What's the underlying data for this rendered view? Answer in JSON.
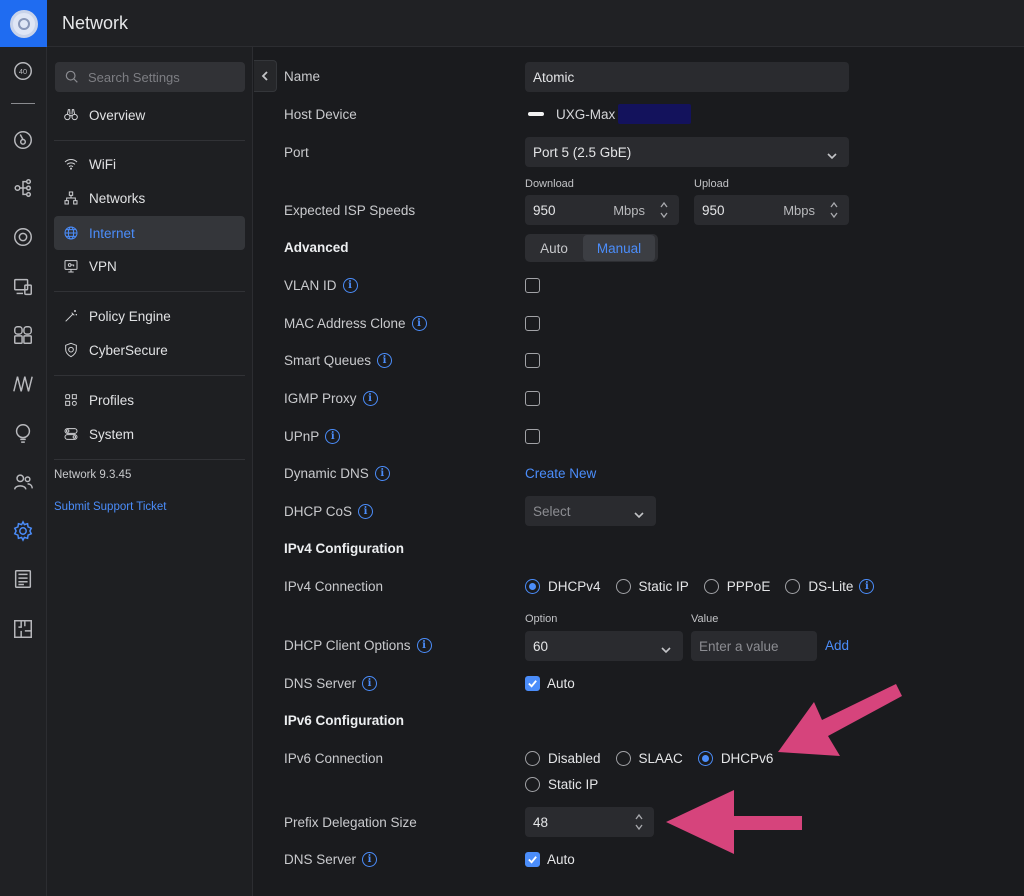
{
  "app": {
    "title": "Network"
  },
  "sidebar": {
    "search_placeholder": "Search Settings",
    "items": [
      {
        "label": "Overview",
        "icon": "binoculars-icon"
      },
      {
        "label": "WiFi",
        "icon": "wifi-icon"
      },
      {
        "label": "Networks",
        "icon": "network-tree-icon"
      },
      {
        "label": "Internet",
        "icon": "globe-icon",
        "active": true
      },
      {
        "label": "VPN",
        "icon": "vpn-monitor-icon"
      },
      {
        "label": "Policy Engine",
        "icon": "wand-icon"
      },
      {
        "label": "CyberSecure",
        "icon": "shield-icon"
      },
      {
        "label": "Profiles",
        "icon": "profiles-grid-icon"
      },
      {
        "label": "System",
        "icon": "toggles-icon"
      }
    ],
    "version": "Network 9.3.45",
    "support_link": "Submit Support Ticket"
  },
  "form": {
    "name": {
      "label": "Name",
      "value": "Atomic"
    },
    "host_device": {
      "label": "Host Device",
      "value": "UXG-Max"
    },
    "port": {
      "label": "Port",
      "value": "Port 5 (2.5 GbE)"
    },
    "isp": {
      "label": "Expected ISP Speeds",
      "download_caption": "Download",
      "upload_caption": "Upload",
      "download_value": "950",
      "upload_value": "950",
      "unit": "Mbps"
    },
    "advanced": {
      "label": "Advanced",
      "options": [
        "Auto",
        "Manual"
      ],
      "selected": "Manual"
    },
    "vlan_id": {
      "label": "VLAN ID"
    },
    "mac_clone": {
      "label": "MAC Address Clone"
    },
    "smart_queues": {
      "label": "Smart Queues"
    },
    "igmp_proxy": {
      "label": "IGMP Proxy"
    },
    "upnp": {
      "label": "UPnP"
    },
    "dynamic_dns": {
      "label": "Dynamic DNS",
      "action": "Create New"
    },
    "dhcp_cos": {
      "label": "DHCP CoS",
      "placeholder": "Select"
    },
    "ipv4_section": "IPv4 Configuration",
    "ipv4_connection": {
      "label": "IPv4 Connection",
      "options": [
        "DHCPv4",
        "Static IP",
        "PPPoE",
        "DS-Lite"
      ],
      "selected": "DHCPv4"
    },
    "dhcp_client_options": {
      "label": "DHCP Client Options",
      "option_caption": "Option",
      "value_caption": "Value",
      "option_value": "60",
      "value_placeholder": "Enter a value",
      "add_label": "Add"
    },
    "dns_server_v4": {
      "label": "DNS Server",
      "checkbox_label": "Auto",
      "checked": true
    },
    "ipv6_section": "IPv6 Configuration",
    "ipv6_connection": {
      "label": "IPv6 Connection",
      "options": [
        "Disabled",
        "SLAAC",
        "DHCPv6",
        "Static IP"
      ],
      "selected": "DHCPv6"
    },
    "prefix_delegation": {
      "label": "Prefix Delegation Size",
      "value": "48"
    },
    "dns_server_v6": {
      "label": "DNS Server",
      "checkbox_label": "Auto",
      "checked": true
    }
  },
  "colors": {
    "accent": "#4b8dfa",
    "annotation_arrow": "#d6447c",
    "brand": "#1f6cf1"
  }
}
